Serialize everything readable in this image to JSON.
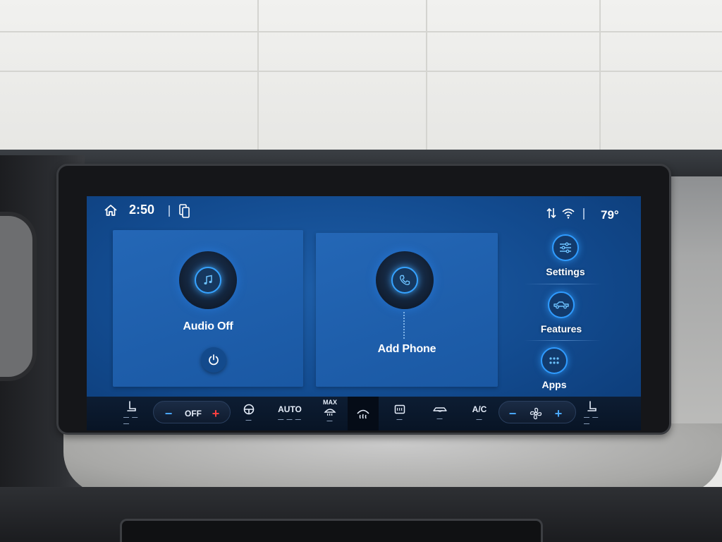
{
  "status_bar": {
    "home_icon": "home-icon",
    "time": "2:50",
    "stack_icon": "phone-projection-icon",
    "signal_icon": "signal-arrows-icon",
    "wifi_icon": "wifi-icon",
    "outside_temp": "79°"
  },
  "cards": {
    "audio": {
      "label": "Audio Off",
      "icon": "music-note-icon",
      "power_icon": "power-icon"
    },
    "phone": {
      "label": "Add Phone",
      "icon": "phone-icon"
    }
  },
  "shortcuts": [
    {
      "label": "Settings",
      "icon": "sliders-icon"
    },
    {
      "label": "Features",
      "icon": "truck-icon"
    },
    {
      "label": "Apps",
      "icon": "grid-icon"
    }
  ],
  "climate_bar": {
    "driver_seat_icon": "seat-icon",
    "driver_temp": {
      "minus": "−",
      "value": "OFF",
      "plus": "+"
    },
    "steering_heat_icon": "heated-steering-icon",
    "auto_label": "AUTO",
    "max_defrost": {
      "label": "MAX",
      "icon": "defrost-icon"
    },
    "front_defrost_icon": "defrost-front-icon",
    "rear_defrost_icon": "rear-defrost-icon",
    "recirc_icon": "recirculate-icon",
    "ac_label": "A/C",
    "fan": {
      "minus": "−",
      "icon": "fan-icon",
      "plus": "+"
    },
    "passenger_seat_icon": "seat-icon",
    "indicator": "— — —"
  },
  "colors": {
    "screen_blue": "#124a8e",
    "accent_blue": "#2f9bff",
    "temp_plus_red": "#ff4040"
  }
}
